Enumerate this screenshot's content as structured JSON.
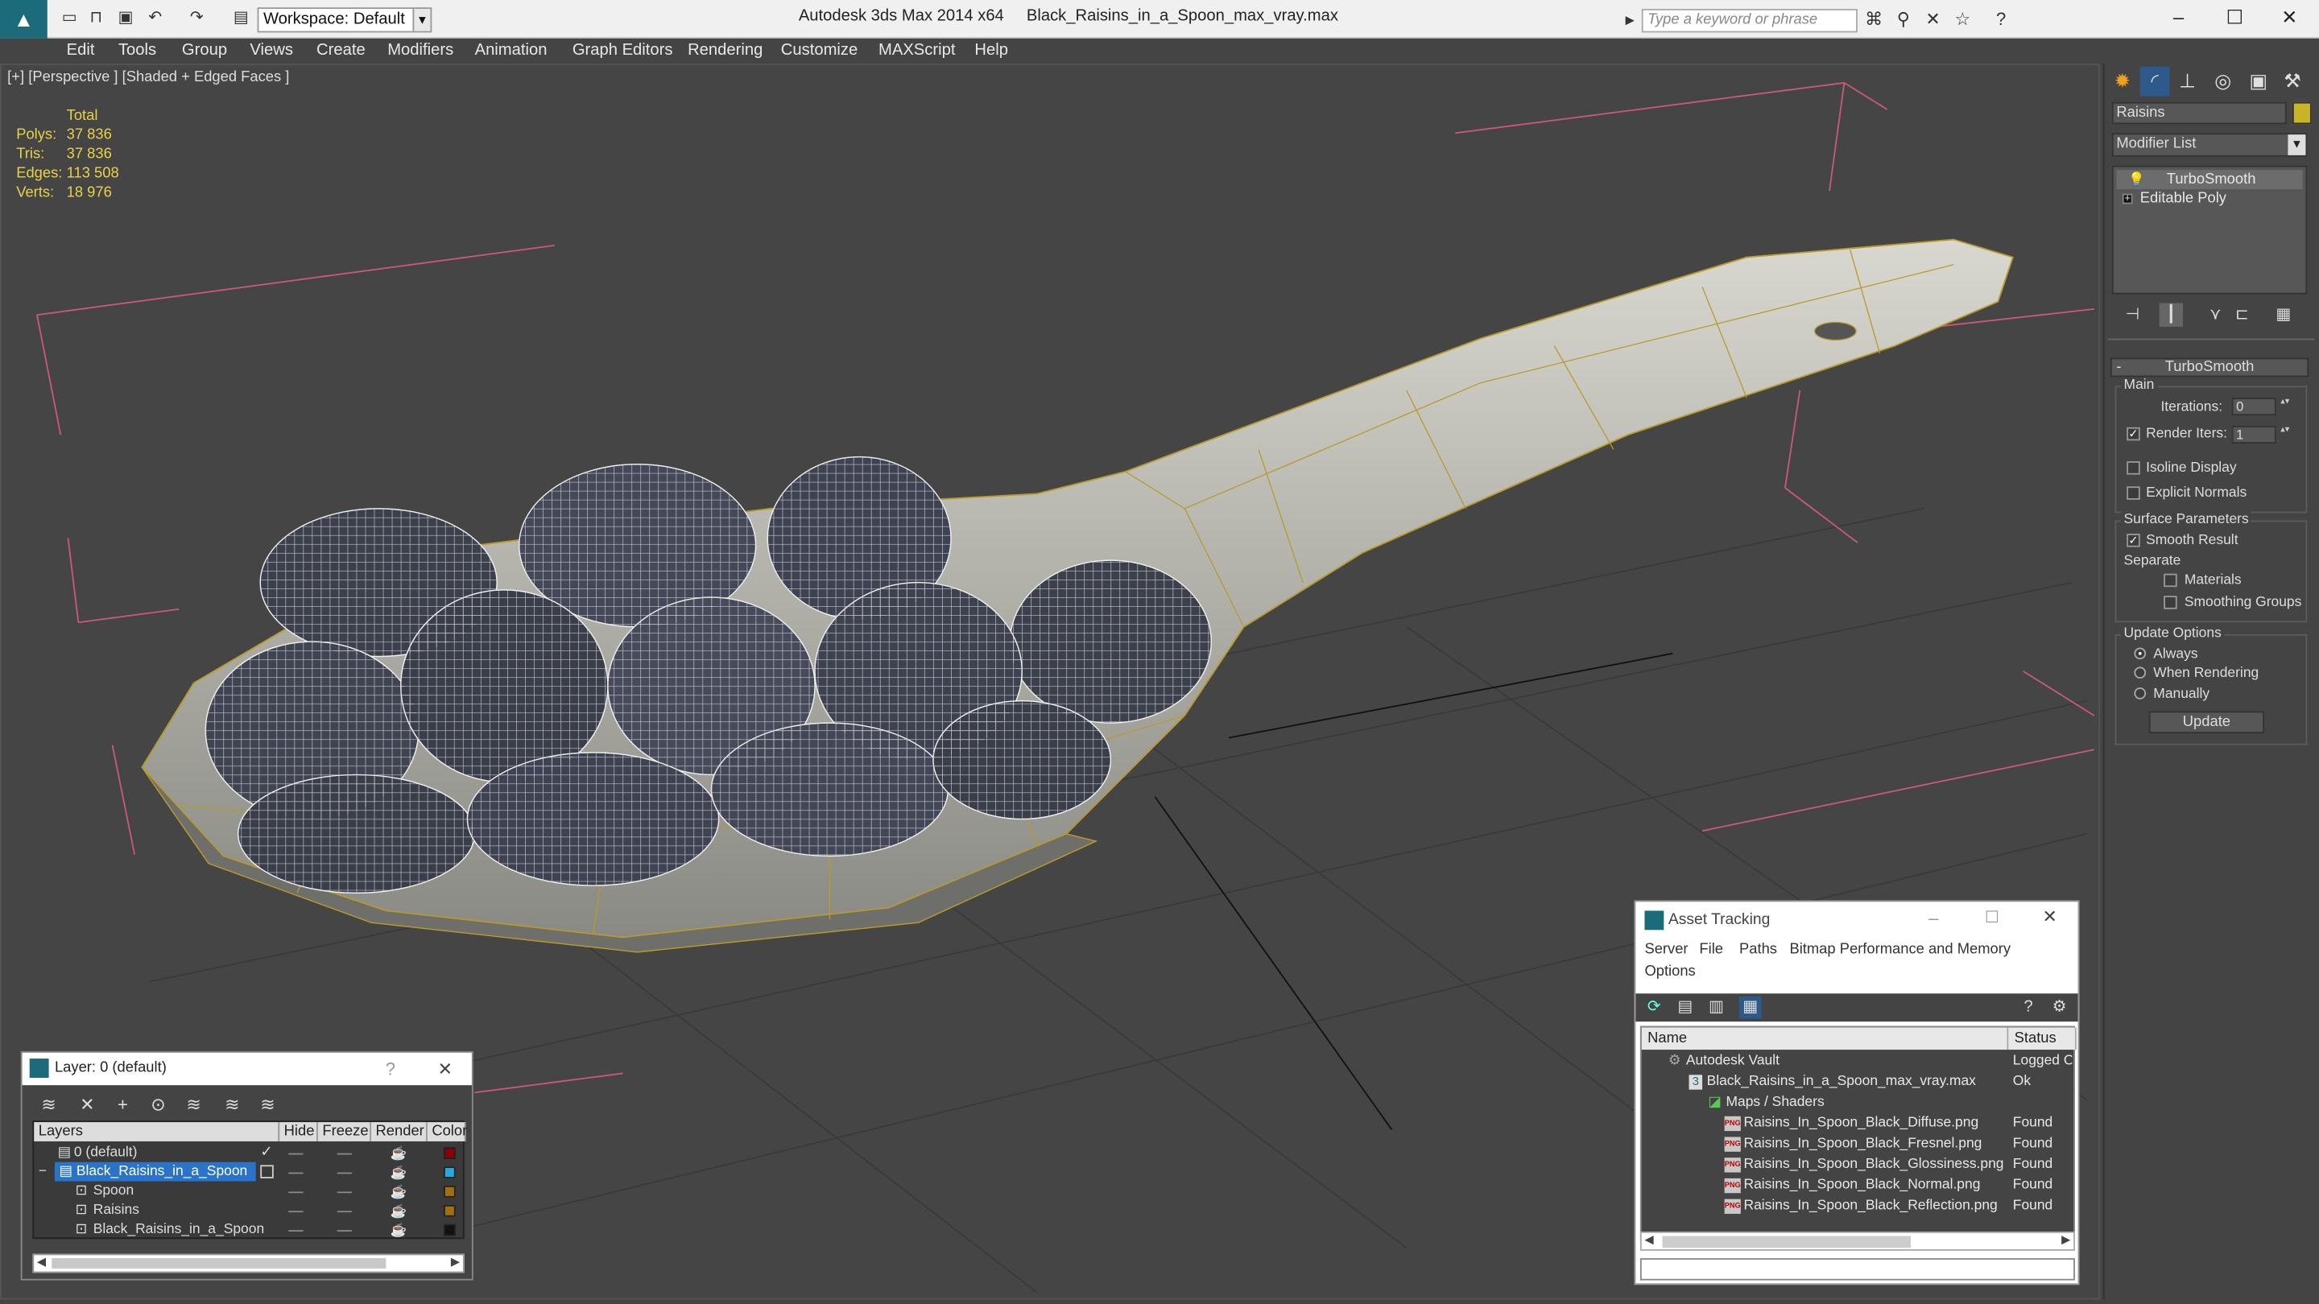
{
  "titlebar": {
    "workspace_label": "Workspace: Default",
    "app_title": "Autodesk 3ds Max  2014 x64",
    "file_title": "Black_Raisins_in_a_Spoon_max_vray.max",
    "search_placeholder": "Type a keyword or phrase"
  },
  "menu": [
    "Edit",
    "Tools",
    "Group",
    "Views",
    "Create",
    "Modifiers",
    "Animation",
    "Graph Editors",
    "Rendering",
    "Customize",
    "MAXScript",
    "Help"
  ],
  "viewport": {
    "label": "[+] [Perspective ] [Shaded + Edged Faces ]",
    "stats": {
      "header": "Total",
      "polys_label": "Polys:",
      "polys": "37 836",
      "tris_label": "Tris:",
      "tris": "37 836",
      "edges_label": "Edges:",
      "edges": "113 508",
      "verts_label": "Verts:",
      "verts": "18 976"
    }
  },
  "command_panel": {
    "object_name": "Raisins",
    "object_color": "#c8b424",
    "modifier_list": "Modifier List",
    "stack": [
      "TurboSmooth",
      "Editable Poly"
    ],
    "rollout_title": "TurboSmooth",
    "main_label": "Main",
    "iterations_label": "Iterations:",
    "iterations": "0",
    "render_iters_label": "Render Iters:",
    "render_iters": "1",
    "render_iters_checked": true,
    "isoline_label": "Isoline Display",
    "explicit_normals_label": "Explicit Normals",
    "surface_params_label": "Surface Parameters",
    "smooth_result_label": "Smooth Result",
    "separate_label": "Separate",
    "materials_label": "Materials",
    "smoothing_groups_label": "Smoothing Groups",
    "update_options_label": "Update Options",
    "always_label": "Always",
    "when_rendering_label": "When Rendering",
    "manually_label": "Manually",
    "update_button": "Update"
  },
  "layer_dialog": {
    "title": "Layer: 0 (default)",
    "help": "?",
    "columns": [
      "Layers",
      "Hide",
      "Freeze",
      "Render",
      "Color"
    ],
    "rows": [
      {
        "name": "0 (default)",
        "color": "#8b0000",
        "indent": 0
      },
      {
        "name": "Black_Raisins_in_a_Spoon",
        "color": "#2aa8d8",
        "indent": 0,
        "selected": true
      },
      {
        "name": "Spoon",
        "color": "#a07010",
        "indent": 1
      },
      {
        "name": "Raisins",
        "color": "#a07010",
        "indent": 1
      },
      {
        "name": "Black_Raisins_in_a_Spoon",
        "color": "#111111",
        "indent": 1
      }
    ]
  },
  "asset_dialog": {
    "title": "Asset Tracking",
    "menu": [
      "Server",
      "File",
      "Paths",
      "Bitmap Performance and Memory",
      "Options"
    ],
    "columns": [
      "Name",
      "Status"
    ],
    "rows": [
      {
        "name": "Autodesk Vault",
        "status": "Logged Out",
        "indent": 0
      },
      {
        "name": "Black_Raisins_in_a_Spoon_max_vray.max",
        "status": "Ok",
        "indent": 1
      },
      {
        "name": "Maps / Shaders",
        "status": "",
        "indent": 2
      },
      {
        "name": "Raisins_In_Spoon_Black_Diffuse.png",
        "status": "Found",
        "indent": 3
      },
      {
        "name": "Raisins_In_Spoon_Black_Fresnel.png",
        "status": "Found",
        "indent": 3
      },
      {
        "name": "Raisins_In_Spoon_Black_Glossiness.png",
        "status": "Found",
        "indent": 3
      },
      {
        "name": "Raisins_In_Spoon_Black_Normal.png",
        "status": "Found",
        "indent": 3
      },
      {
        "name": "Raisins_In_Spoon_Black_Reflection.png",
        "status": "Found",
        "indent": 3
      }
    ]
  }
}
